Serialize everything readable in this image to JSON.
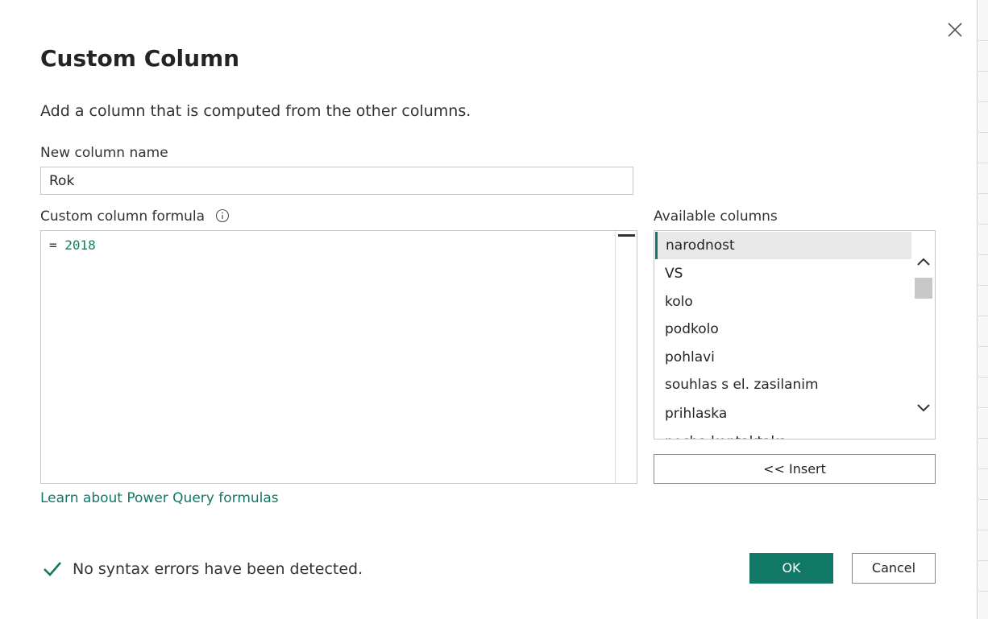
{
  "dialog": {
    "title": "Custom Column",
    "subtitle": "Add a column that is computed from the other columns.",
    "close_icon": "close-icon"
  },
  "name_field": {
    "label": "New column name",
    "value": "Rok"
  },
  "formula": {
    "label": "Custom column formula",
    "prefix": "= ",
    "value": "2018",
    "info_icon": "info-icon",
    "number_color": "#098658"
  },
  "available_columns": {
    "label": "Available columns",
    "items": [
      {
        "label": "narodnost",
        "selected": true
      },
      {
        "label": "VS",
        "selected": false
      },
      {
        "label": "kolo",
        "selected": false
      },
      {
        "label": "podkolo",
        "selected": false
      },
      {
        "label": "pohlavi",
        "selected": false
      },
      {
        "label": "souhlas s el. zasilanim",
        "selected": false
      },
      {
        "label": "prihlaska",
        "selected": false
      },
      {
        "label": "pocha kontaktaka",
        "selected": false
      }
    ],
    "insert_label": "<< Insert"
  },
  "learn_link": "Learn about Power Query formulas",
  "status": {
    "text": "No syntax errors have been detected.",
    "icon": "checkmark-icon",
    "icon_color": "#117865"
  },
  "buttons": {
    "ok": "OK",
    "cancel": "Cancel"
  },
  "colors": {
    "accent": "#117865",
    "selected_bg": "#e8e8e8"
  }
}
